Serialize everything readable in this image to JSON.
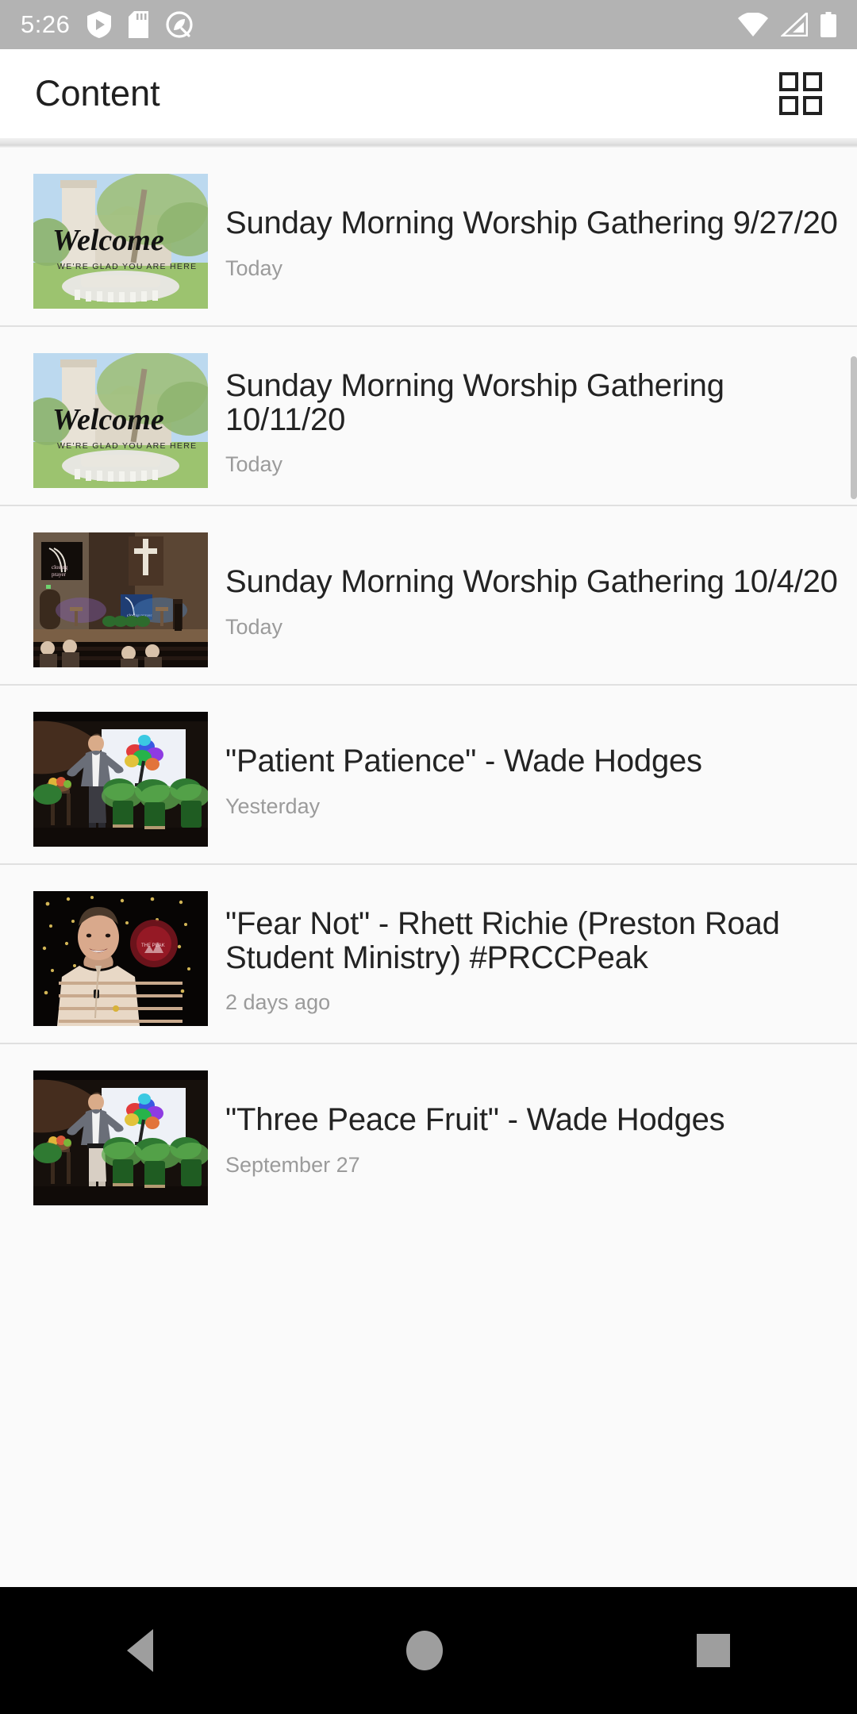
{
  "status_bar": {
    "time": "5:26",
    "left_icons": [
      "shield-play-icon",
      "sd-card-icon",
      "circle-q-icon"
    ],
    "right_icons": [
      "wifi-icon",
      "cellular-signal-icon",
      "battery-icon"
    ],
    "background_color": "#b3b3b3"
  },
  "app_bar": {
    "title": "Content",
    "action_icon": "grid-view-icon"
  },
  "list": {
    "items": [
      {
        "title": "Sunday Morning Worship Gathering 9/27/20",
        "timestamp": "Today",
        "thumbnail": "welcome-church-sign-thumbnail",
        "thumbnail_text_primary": "Welcome",
        "thumbnail_text_secondary": "WE'RE GLAD YOU ARE HERE"
      },
      {
        "title": "Sunday Morning Worship Gathering 10/11/20",
        "timestamp": "Today",
        "thumbnail": "welcome-church-sign-thumbnail",
        "thumbnail_text_primary": "Welcome",
        "thumbnail_text_secondary": "WE'RE GLAD YOU ARE HERE"
      },
      {
        "title": "Sunday Morning Worship Gathering 10/4/20",
        "timestamp": "Today",
        "thumbnail": "sanctuary-closing-prayer-thumbnail",
        "thumbnail_text_primary": "closing prayer",
        "thumbnail_text_secondary": ""
      },
      {
        "title": "\"Patient Patience\" - Wade Hodges",
        "timestamp": "Yesterday",
        "thumbnail": "speaker-colorful-tree-stage-thumbnail",
        "thumbnail_text_primary": "",
        "thumbnail_text_secondary": ""
      },
      {
        "title": "\"Fear Not\" - Rhett Richie (Preston Road Student Ministry) #PRCCPeak",
        "timestamp": "2 days ago",
        "thumbnail": "student-minister-string-lights-thumbnail",
        "thumbnail_text_primary": "",
        "thumbnail_text_secondary": ""
      },
      {
        "title": "\"Three Peace Fruit\" - Wade Hodges",
        "timestamp": "September 27",
        "thumbnail": "speaker-colorful-tree-stage-thumbnail",
        "thumbnail_text_primary": "",
        "thumbnail_text_secondary": ""
      }
    ]
  },
  "nav_bar": {
    "back_label": "back-button",
    "home_label": "home-button",
    "recents_label": "recents-button",
    "background_color": "#000000"
  }
}
